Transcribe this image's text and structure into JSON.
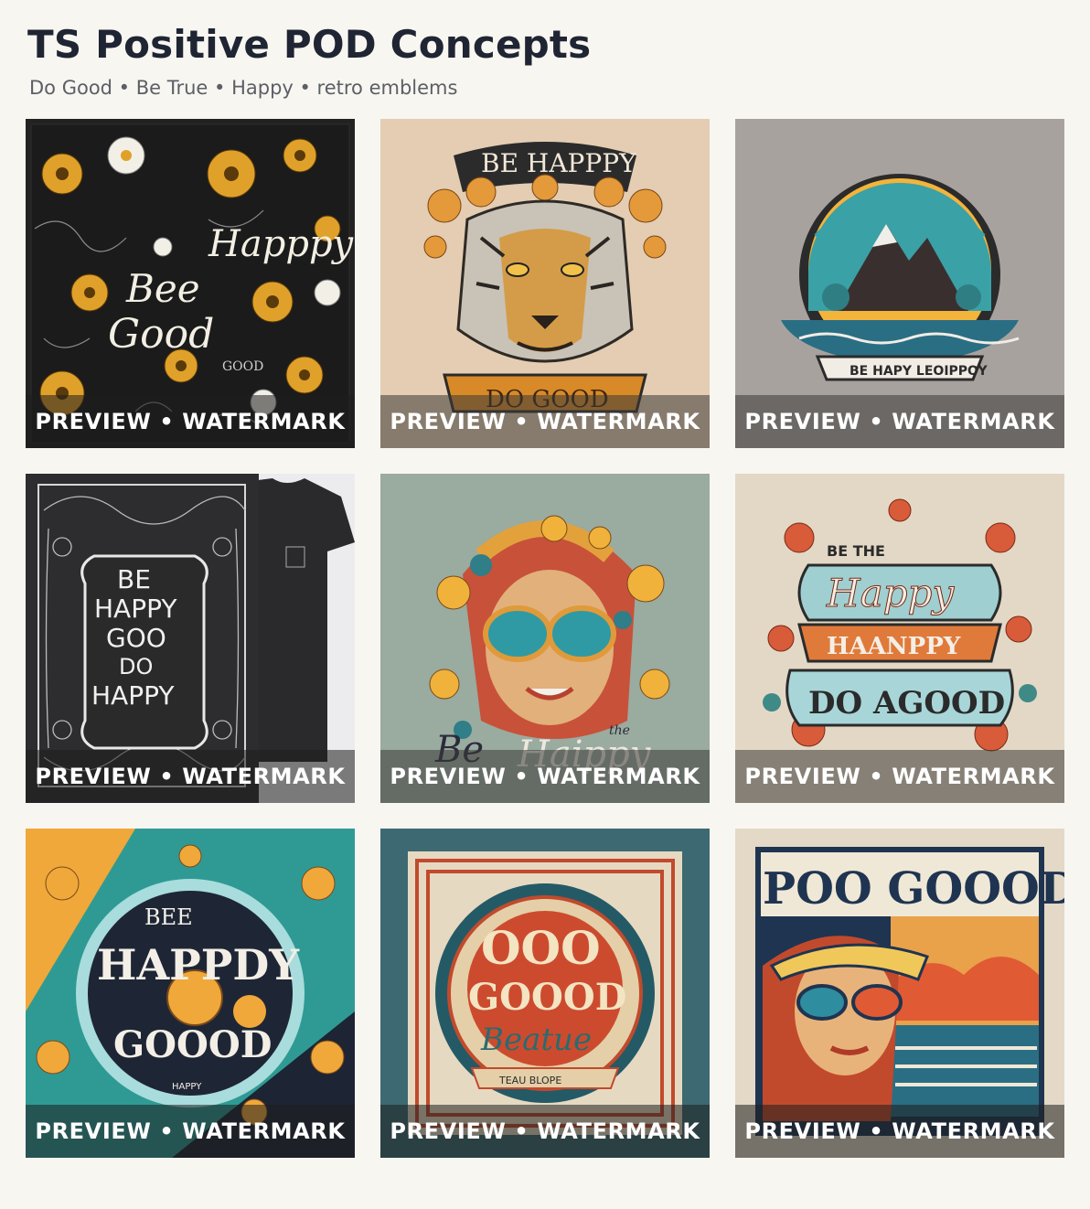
{
  "header": {
    "title": "TS Positive POD Concepts",
    "subtitle": "Do Good • Be True • Happy • retro emblems"
  },
  "tiles": [
    {
      "watermark": "PREVIEW • WATERMARK",
      "art_text": [
        "Happpy",
        "Bee",
        "Good",
        "GOOD"
      ]
    },
    {
      "watermark": "PREVIEW • WATERMARK",
      "art_text": [
        "BE HAPPPY",
        "DO GOOD"
      ]
    },
    {
      "watermark": "PREVIEW • WATERMARK",
      "art_text": [
        "BE HAPY LEOIPPOY"
      ]
    },
    {
      "watermark": "PREVIEW • WATERMARK",
      "art_text": [
        "BE",
        "HAPPY",
        "GOO",
        "DO",
        "HAPPY"
      ]
    },
    {
      "watermark": "PREVIEW • WATERMARK",
      "art_text": [
        "Be",
        "Haippy",
        "the"
      ]
    },
    {
      "watermark": "PREVIEW • WATERMARK",
      "art_text": [
        "BE THE",
        "Happy",
        "HAANPPY",
        "DO AGOOD"
      ]
    },
    {
      "watermark": "PREVIEW • WATERMARK",
      "art_text": [
        "BEE",
        "HAPPDY",
        "GOOOD",
        "HAPPY"
      ]
    },
    {
      "watermark": "PREVIEW • WATERMARK",
      "art_text": [
        "OOO",
        "GOOOD",
        "Beatue",
        "TEAU BLOPE"
      ]
    },
    {
      "watermark": "PREVIEW • WATERMARK",
      "art_text": [
        "POO GOOOD"
      ]
    }
  ],
  "colors": {
    "background": "#f8f6f1",
    "title": "#1f2533",
    "subtitle": "#5b5f66",
    "watermark_text": "#ffffff"
  }
}
